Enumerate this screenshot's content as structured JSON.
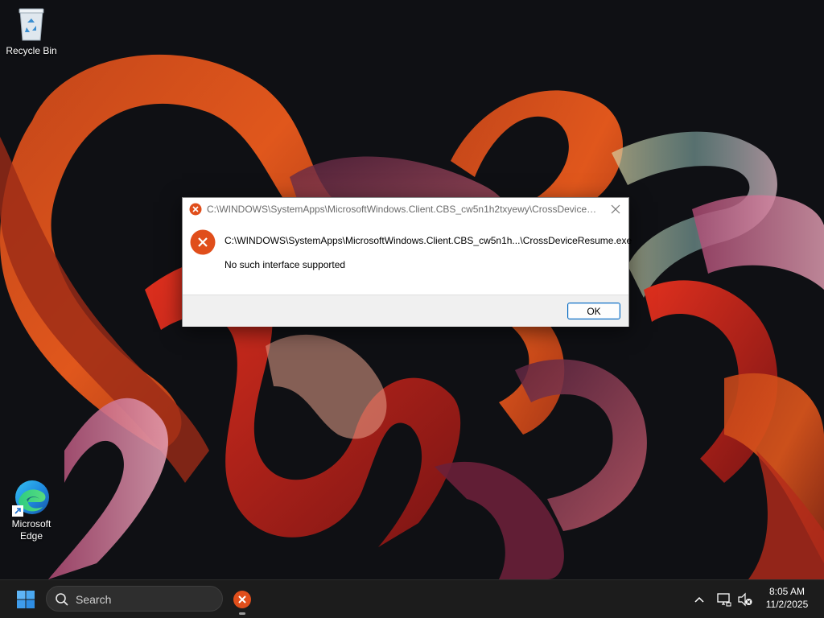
{
  "desktop": {
    "icons": [
      {
        "label": "Recycle Bin",
        "icon": "recycle-bin-icon"
      },
      {
        "label": "Microsoft\nEdge",
        "icon": "edge-icon"
      }
    ]
  },
  "dialog": {
    "title": "C:\\WINDOWS\\SystemApps\\MicrosoftWindows.Client.CBS_cw5n1h2txyewy\\CrossDeviceResume.exe",
    "path": "C:\\WINDOWS\\SystemApps\\MicrosoftWindows.Client.CBS_cw5n1h...\\CrossDeviceResume.exe",
    "message": "No such interface supported",
    "ok_label": "OK",
    "icon": "error-icon",
    "accent": "#e04e1b"
  },
  "taskbar": {
    "search_placeholder": "Search",
    "clock": {
      "time": "8:05 AM",
      "date": "11/2/2025"
    },
    "icons": [
      "windows-start-icon",
      "search-icon",
      "error-app-icon",
      "chevron-up-icon",
      "network-icon",
      "volume-muted-icon"
    ]
  },
  "colors": {
    "taskbar_bg": "#1c1c1c",
    "desktop_bg": "#0f1014",
    "ok_border": "#0067c0"
  }
}
